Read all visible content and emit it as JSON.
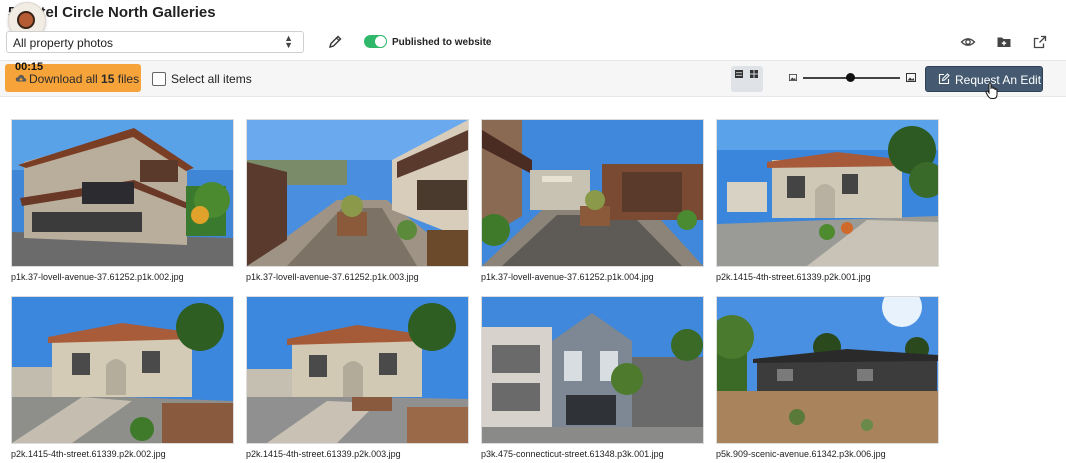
{
  "header": {
    "title": "5 Hotel Circle North Galleries",
    "photo_filter": "All property photos",
    "published_label": "Published to website",
    "recording_timer": "00:15"
  },
  "toolbar": {
    "download_prefix": "Download all ",
    "download_count": "15",
    "download_suffix": " files",
    "select_all_label": "Select all items",
    "edit_label": "Request An Edit"
  },
  "photos": [
    {
      "caption": "p1k.37-lovell-avenue-37.61252.p1k.002.jpg",
      "icon": "modern-house-exterior"
    },
    {
      "caption": "p1k.37-lovell-avenue-37.61252.p1k.003.jpg",
      "icon": "courtyard-walkway"
    },
    {
      "caption": "p1k.37-lovell-avenue-37.61252.p1k.004.jpg",
      "icon": "courtyard-patio"
    },
    {
      "caption": "p2k.1415-4th-street.61339.p2k.001.jpg",
      "icon": "stucco-house-front"
    },
    {
      "caption": "p2k.1415-4th-street.61339.p2k.002.jpg",
      "icon": "stucco-house-side"
    },
    {
      "caption": "p2k.1415-4th-street.61339.p2k.003.jpg",
      "icon": "stucco-house-street"
    },
    {
      "caption": "p3k.475-connecticut-street.61348.p3k.001.jpg",
      "icon": "victorian-houses"
    },
    {
      "caption": "p5k.909-scenic-avenue.61342.p3k.006.jpg",
      "icon": "ranch-house"
    }
  ],
  "colors": {
    "download_button": "#f6a43a",
    "edit_button": "#455a71",
    "toggle_on": "#2fb86a",
    "sky": "#3f86d6"
  }
}
